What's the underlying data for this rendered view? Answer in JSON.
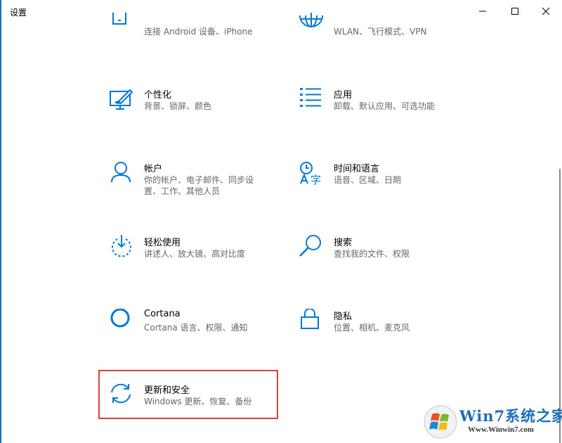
{
  "window": {
    "title": "设置"
  },
  "tiles": [
    {
      "name": "",
      "desc": "连接 Android 设备、iPhone",
      "icon": "phone-icon"
    },
    {
      "name": "",
      "desc": "WLAN、飞行模式、VPN",
      "icon": "globe-icon"
    },
    {
      "name": "个性化",
      "desc": "背景、锁屏、颜色",
      "icon": "personalization-icon"
    },
    {
      "name": "应用",
      "desc": "卸载、默认应用、可选功能",
      "icon": "apps-list-icon"
    },
    {
      "name": "帐户",
      "desc": "你的帐户、电子邮件、同步设置、工作、其他人员",
      "icon": "person-icon"
    },
    {
      "name": "时间和语言",
      "desc": "语音、区域、日期",
      "icon": "time-language-icon"
    },
    {
      "name": "轻松使用",
      "desc": "讲述人、放大镜、高对比度",
      "icon": "ease-of-access-icon"
    },
    {
      "name": "搜索",
      "desc": "查找我的文件、权限",
      "icon": "search-icon"
    },
    {
      "name": "Cortana",
      "desc": "Cortana 语言、权限、通知",
      "icon": "cortana-ring-icon"
    },
    {
      "name": "隐私",
      "desc": "位置、相机、麦克风",
      "icon": "lock-icon"
    },
    {
      "name": "更新和安全",
      "desc": "Windows 更新、恢复、备份",
      "icon": "sync-arrows-icon"
    }
  ],
  "watermark": {
    "text": "Win7系统之家",
    "url": "Www.Winwin7.com"
  },
  "colors": {
    "accent": "#0078d7",
    "highlight": "#e0423b"
  }
}
